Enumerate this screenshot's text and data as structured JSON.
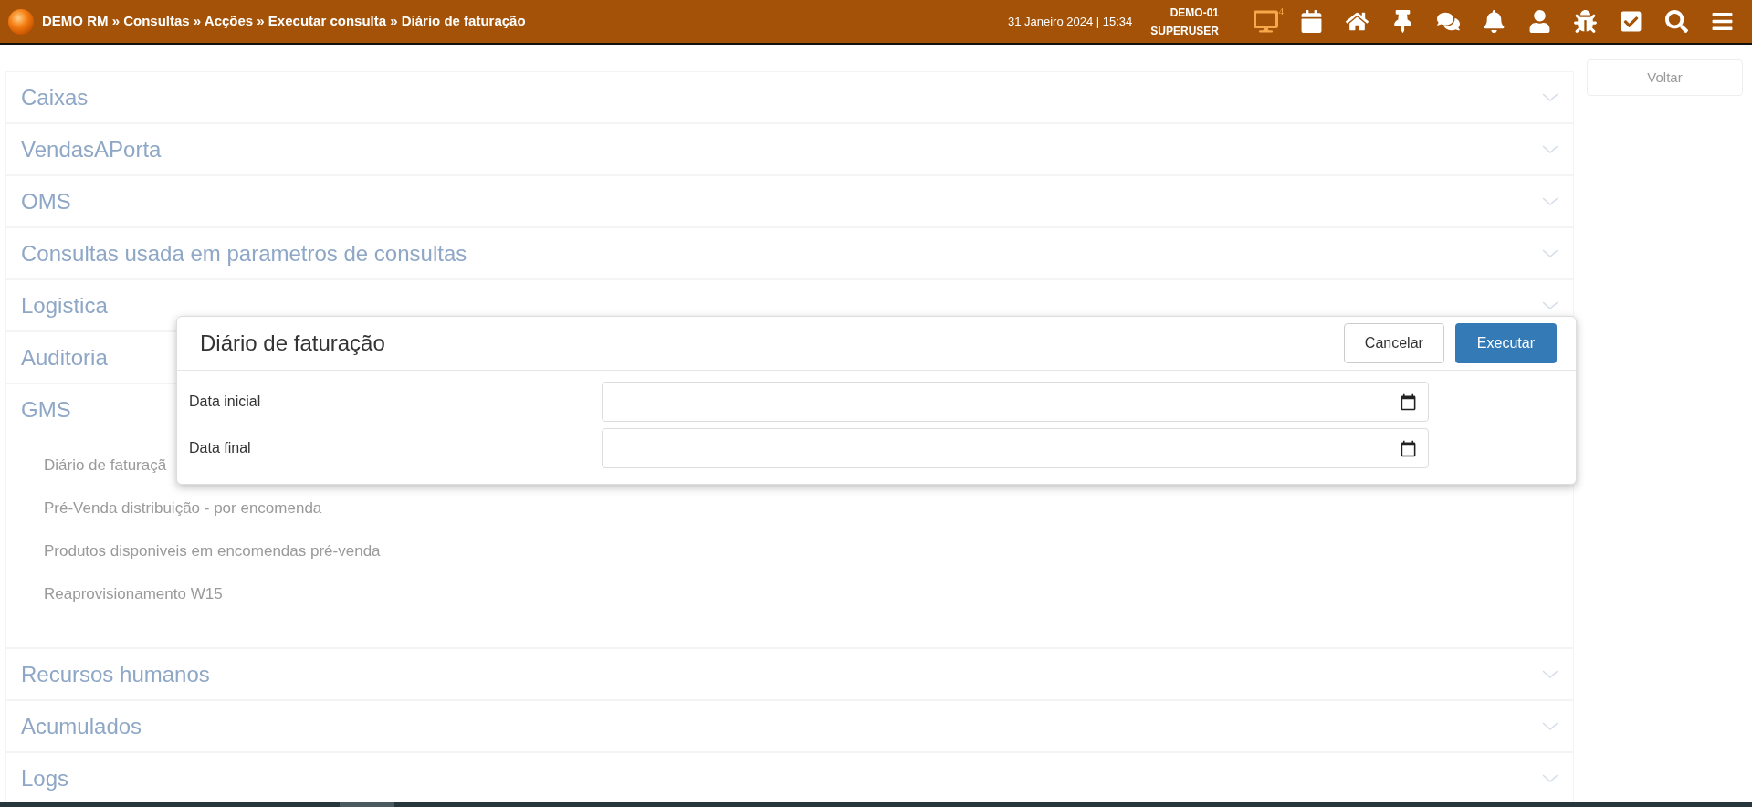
{
  "header": {
    "breadcrumb": "DEMO RM » Consultas » Acções » Executar consulta » Diário de faturação",
    "datetime": "31 Janeiro 2024 | 15:34",
    "company": "DEMO-01",
    "user": "SUPERUSER",
    "monitor_badge": "4"
  },
  "sidebar": {
    "back_button": "Voltar"
  },
  "groups": [
    {
      "label": "Caixas",
      "expanded": false,
      "chevron": true
    },
    {
      "label": "VendasAPorta",
      "expanded": false,
      "chevron": true
    },
    {
      "label": "OMS",
      "expanded": false,
      "chevron": true
    },
    {
      "label": "Consultas usada em parametros de consultas",
      "expanded": false,
      "chevron": true
    },
    {
      "label": "Logistica",
      "expanded": false,
      "chevron": true
    },
    {
      "label": "Auditoria",
      "expanded": false,
      "chevron": false
    },
    {
      "label": "GMS",
      "expanded": true,
      "chevron": false,
      "children": [
        {
          "label": "Diário de faturaçã"
        },
        {
          "label": "Pré-Venda distribuição - por encomenda"
        },
        {
          "label": "Produtos disponiveis em encomendas pré-venda"
        },
        {
          "label": "Reaprovisionamento W15"
        }
      ]
    },
    {
      "label": "Recursos humanos",
      "expanded": false,
      "chevron": true
    },
    {
      "label": "Acumulados",
      "expanded": false,
      "chevron": true
    },
    {
      "label": "Logs",
      "expanded": false,
      "chevron": true
    }
  ],
  "dialog": {
    "title": "Diário de faturação",
    "cancel": "Cancelar",
    "execute": "Executar",
    "fields": [
      {
        "label": "Data inicial"
      },
      {
        "label": "Data final"
      }
    ]
  }
}
